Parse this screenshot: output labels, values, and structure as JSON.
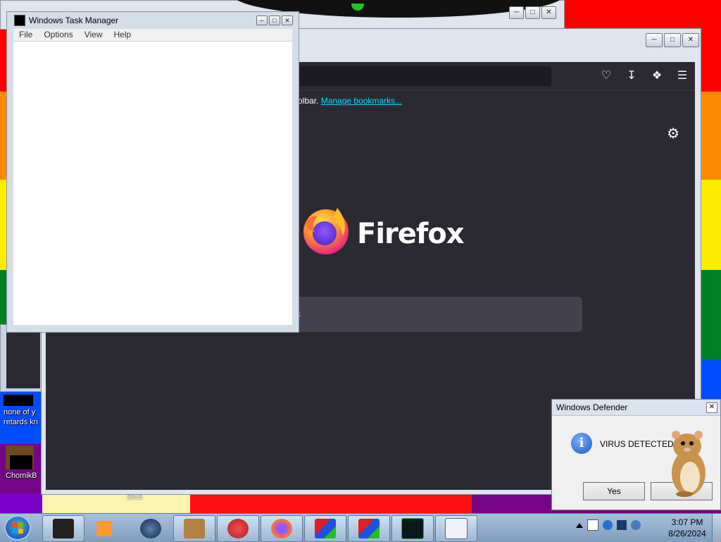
{
  "colors": {
    "rainbow": [
      "#ff0000",
      "#ff8c00",
      "#ffed00",
      "#008026",
      "#004dff",
      "#750787"
    ],
    "firefox_bg": "#2b2a33",
    "link": "#00ddff"
  },
  "desktop": {
    "icons": [
      {
        "label": "none of y\nretards kn"
      },
      {
        "label": "ChomikB"
      }
    ],
    "wall_text": "2015"
  },
  "firefox": {
    "bookmarks_bar": {
      "text": "olbar.",
      "link": "Manage bookmarks..."
    },
    "brand": "Firefox",
    "search_placeholder": "ss",
    "toolbar_icons": [
      "pocket-icon",
      "download-icon",
      "extensions-icon",
      "menu-icon"
    ]
  },
  "task_manager": {
    "title": "Windows Task Manager",
    "menu": [
      "File",
      "Options",
      "View",
      "Help"
    ]
  },
  "defender": {
    "title": "Windows Defender",
    "message": "VIRUS DETECTED!",
    "yes": "Yes"
  },
  "taskbar": {
    "time": "3:07 PM",
    "date": "8/26/2024"
  }
}
